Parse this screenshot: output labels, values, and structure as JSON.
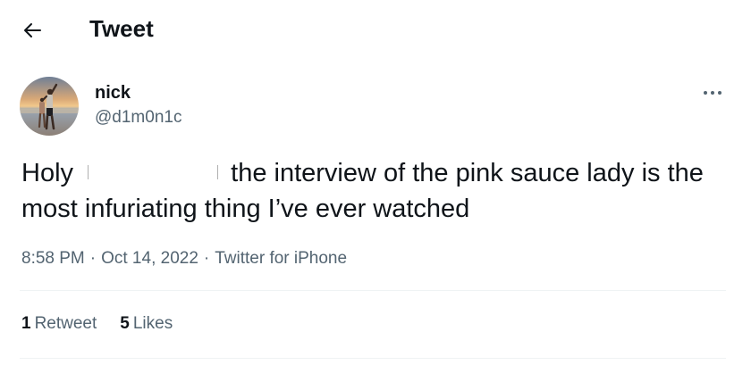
{
  "header": {
    "title": "Tweet",
    "back_icon": "arrow-left-icon"
  },
  "author": {
    "display_name": "nick",
    "handle": "@d1m0n1c",
    "avatar": "profile-photo"
  },
  "tweet": {
    "text_before_redaction": "Holy",
    "text_after_redaction": "the interview of the pink sauce lady is the most infuriating thing I’ve ever watched"
  },
  "meta": {
    "time": "8:58 PM",
    "separator": "·",
    "date": "Oct 14, 2022",
    "source": "Twitter for iPhone"
  },
  "stats": {
    "retweets_count": "1",
    "retweets_label": "Retweet",
    "likes_count": "5",
    "likes_label": "Likes"
  },
  "more_icon": "more-horizontal-icon",
  "colors": {
    "text_primary": "#0f1419",
    "text_secondary": "#536471",
    "divider": "#eff3f4"
  }
}
